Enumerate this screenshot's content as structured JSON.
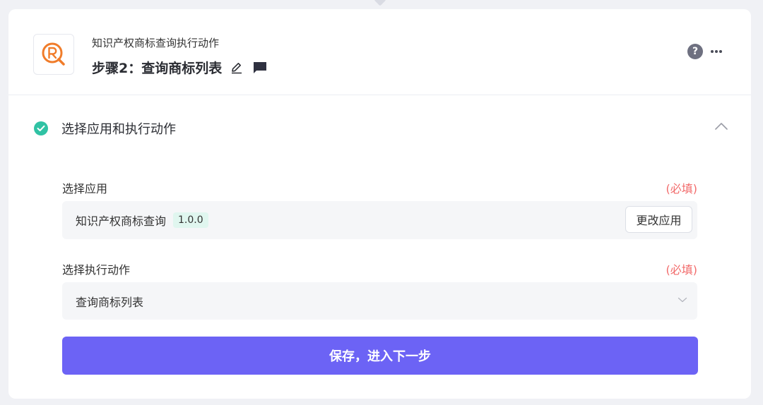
{
  "header": {
    "subtitle": "知识产权商标查询执行动作",
    "title": "步骤2：查询商标列表",
    "help_glyph": "?"
  },
  "section": {
    "title": "选择应用和执行动作"
  },
  "app_field": {
    "label": "选择应用",
    "required": "(必填)",
    "app_name": "知识产权商标查询",
    "version": "1.0.0",
    "change_label": "更改应用"
  },
  "action_field": {
    "label": "选择执行动作",
    "required": "(必填)",
    "value": "查询商标列表"
  },
  "save_button": {
    "label": "保存，进入下一步"
  },
  "colors": {
    "accent": "#6c63f5",
    "success": "#30c2a4",
    "required": "#f26b6b",
    "logo": "#f07c2a"
  }
}
